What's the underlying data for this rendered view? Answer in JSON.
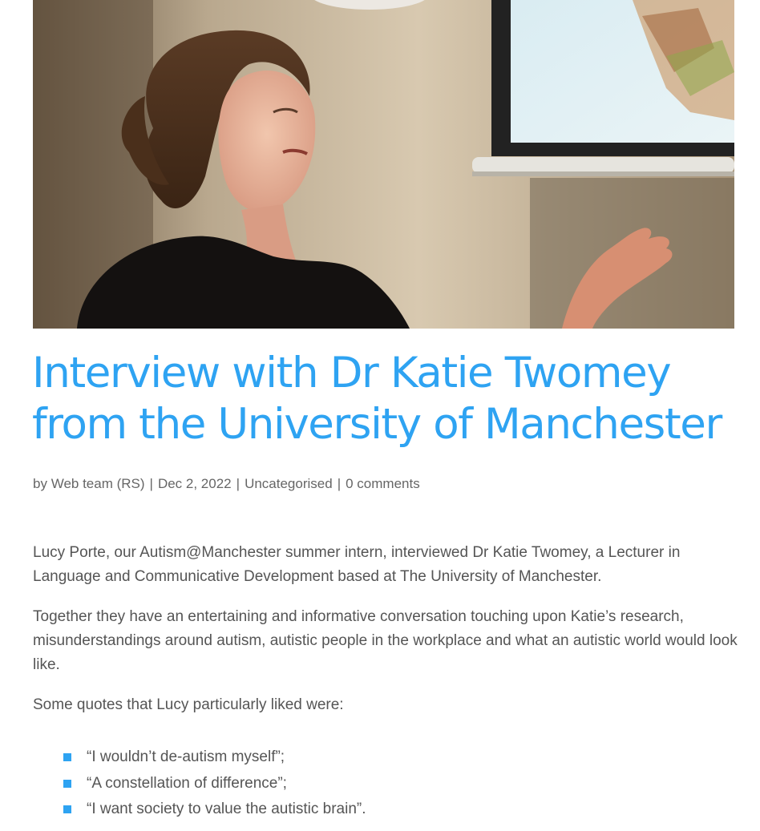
{
  "post": {
    "hero_image": {
      "description_icon": "photo-icon",
      "alt": "Dr Katie Twomey presenting"
    },
    "title": "Interview with Dr Katie Twomey from the University of Manchester",
    "meta": {
      "by_prefix": "by",
      "author": "Web team (RS)",
      "separator": "|",
      "date": "Dec 2, 2022",
      "category": "Uncategorised",
      "comments": "0 comments"
    },
    "paragraphs": [
      "Lucy Porte, our Autism@Manchester summer intern, interviewed Dr Katie Twomey, a Lecturer in Language and Communicative Development based at The University of Manchester.",
      "Together they have an entertaining and informative conversation touching upon Katie’s research, misunderstandings around autism, autistic people in the workplace and what an autistic world would look like.",
      "Some quotes that Lucy particularly liked were:"
    ],
    "quotes": [
      "“I wouldn’t de-autism myself”;",
      "“A constellation of difference”;",
      "“I want society to value the autistic brain”."
    ]
  },
  "colors": {
    "accent": "#2ea3f2",
    "text": "#555555",
    "meta": "#666666"
  }
}
